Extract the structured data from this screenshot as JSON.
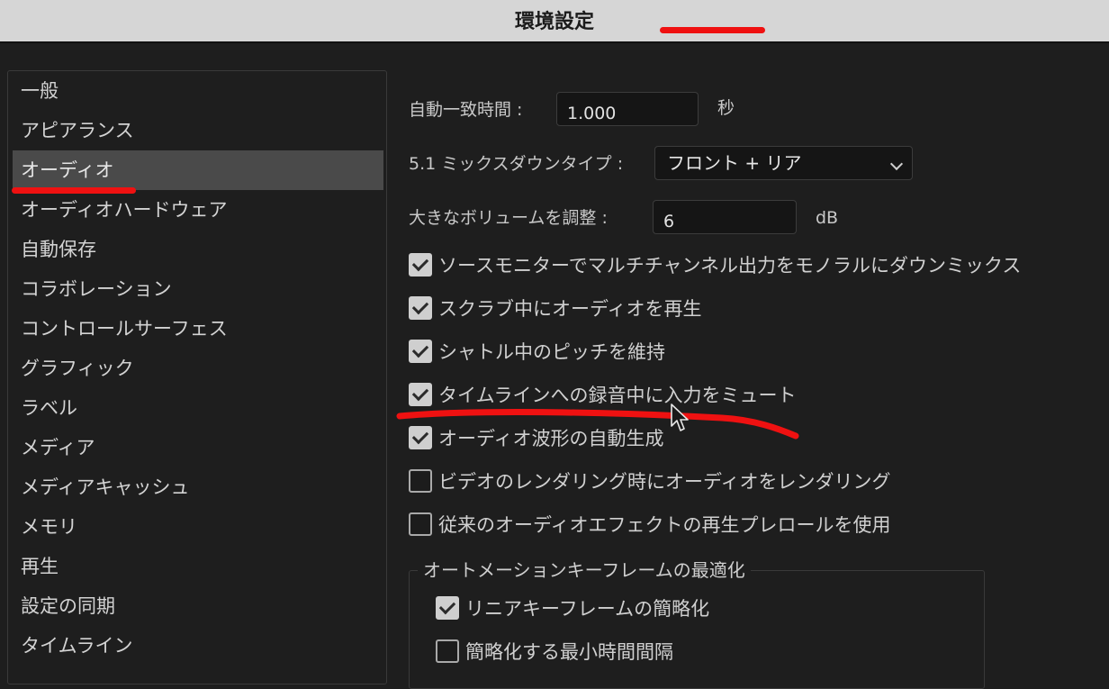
{
  "window": {
    "title": "環境設定",
    "annotation_color": "#ef1111"
  },
  "sidebar": {
    "items": [
      {
        "label": "一般"
      },
      {
        "label": "アピアランス"
      },
      {
        "label": "オーディオ",
        "active": true
      },
      {
        "label": "オーディオハードウェア"
      },
      {
        "label": "自動保存"
      },
      {
        "label": "コラボレーション"
      },
      {
        "label": "コントロールサーフェス"
      },
      {
        "label": "グラフィック"
      },
      {
        "label": "ラベル"
      },
      {
        "label": "メディア"
      },
      {
        "label": "メディアキャッシュ"
      },
      {
        "label": "メモリ"
      },
      {
        "label": "再生"
      },
      {
        "label": "設定の同期"
      },
      {
        "label": "タイムライン"
      }
    ]
  },
  "audio": {
    "auto_match": {
      "label": "自動一致時間 :",
      "value": "1.000",
      "unit": "秒"
    },
    "downmix": {
      "label": "5.1 ミックスダウンタイプ :",
      "value": "フロント + リア",
      "icon": "chevron-down-icon"
    },
    "volume": {
      "label": "大きなボリュームを調整 :",
      "value": "6",
      "unit": "dB"
    },
    "checkboxes": [
      {
        "label": "ソースモニターでマルチチャンネル出力をモノラルにダウンミックス",
        "checked": true
      },
      {
        "label": "スクラブ中にオーディオを再生",
        "checked": true
      },
      {
        "label": "シャトル中のピッチを維持",
        "checked": true
      },
      {
        "label": "タイムラインへの録音中に入力をミュート",
        "checked": true
      },
      {
        "label": "オーディオ波形の自動生成",
        "checked": true
      },
      {
        "label": "ビデオのレンダリング時にオーディオをレンダリング",
        "checked": false
      },
      {
        "label": "従来のオーディオエフェクトの再生プレロールを使用",
        "checked": false
      }
    ],
    "automation_group": {
      "title": "オートメーションキーフレームの最適化",
      "checkboxes": [
        {
          "label": "リニアキーフレームの簡略化",
          "checked": true
        },
        {
          "label": "簡略化する最小時間間隔",
          "checked": false
        }
      ]
    }
  }
}
